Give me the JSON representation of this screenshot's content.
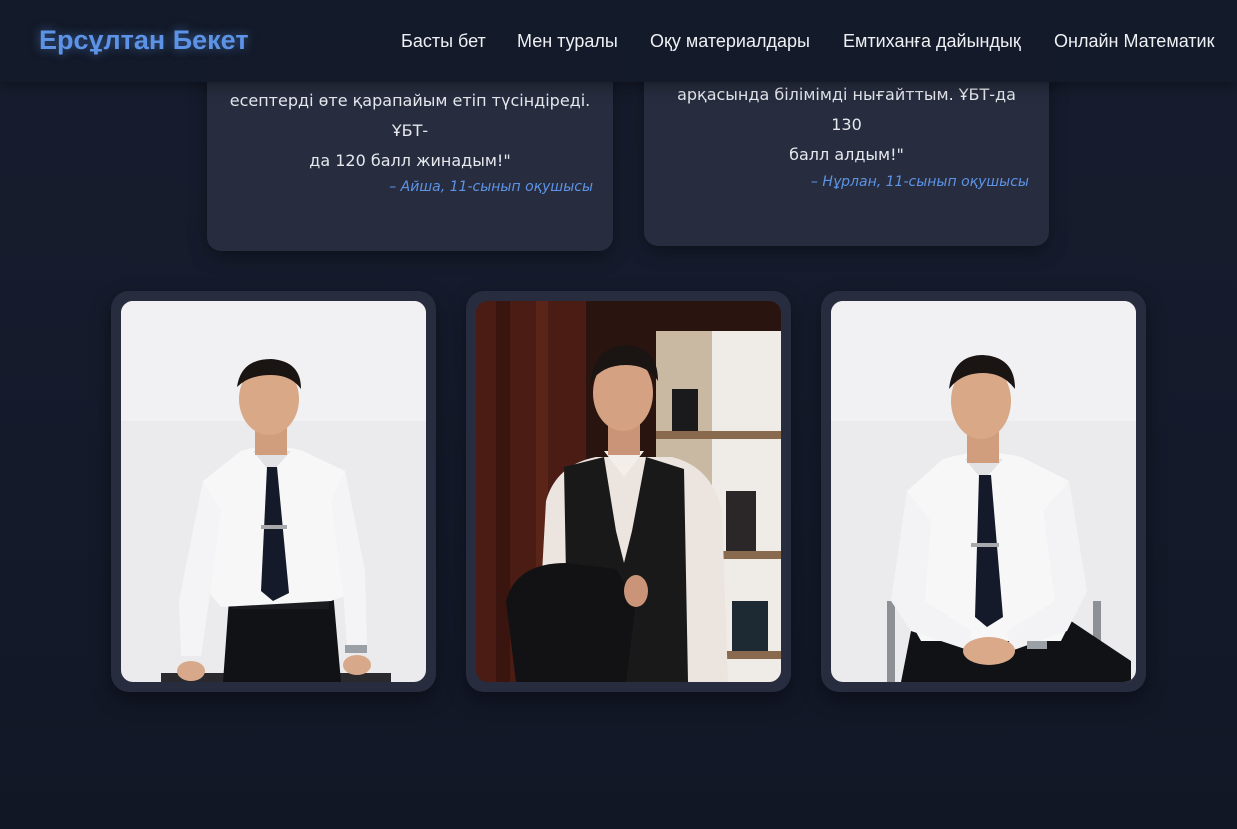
{
  "site": {
    "brand": "Ерсұлтан Бекет"
  },
  "nav": [
    {
      "label": "Басты бет"
    },
    {
      "label": "Мен туралы"
    },
    {
      "label": "Оқу материалдары"
    },
    {
      "label": "Емтиханға дайындық"
    },
    {
      "label": "Онлайн Математик"
    }
  ],
  "testimonials": [
    {
      "lines": [
        "есептерді өте қарапайым етіп түсіндіреді. ҰБТ-",
        "да 120 балл жинадым!\""
      ],
      "author": "– Айша, 11-сынып оқушысы"
    },
    {
      "lines": [
        "арқасында білімімді нығайттым. ҰБТ-да 130",
        "балл алдым!\""
      ],
      "author": "– Нұрлан, 11-сынып оқушысы"
    }
  ],
  "colors": {
    "background": "#151b2c",
    "card": "#272d3f",
    "accent": "#5d93e6",
    "text": "#eef0f4"
  },
  "gallery": [
    {
      "icon": "portrait-standing-photo"
    },
    {
      "icon": "portrait-vest-photo"
    },
    {
      "icon": "portrait-seated-photo"
    }
  ]
}
